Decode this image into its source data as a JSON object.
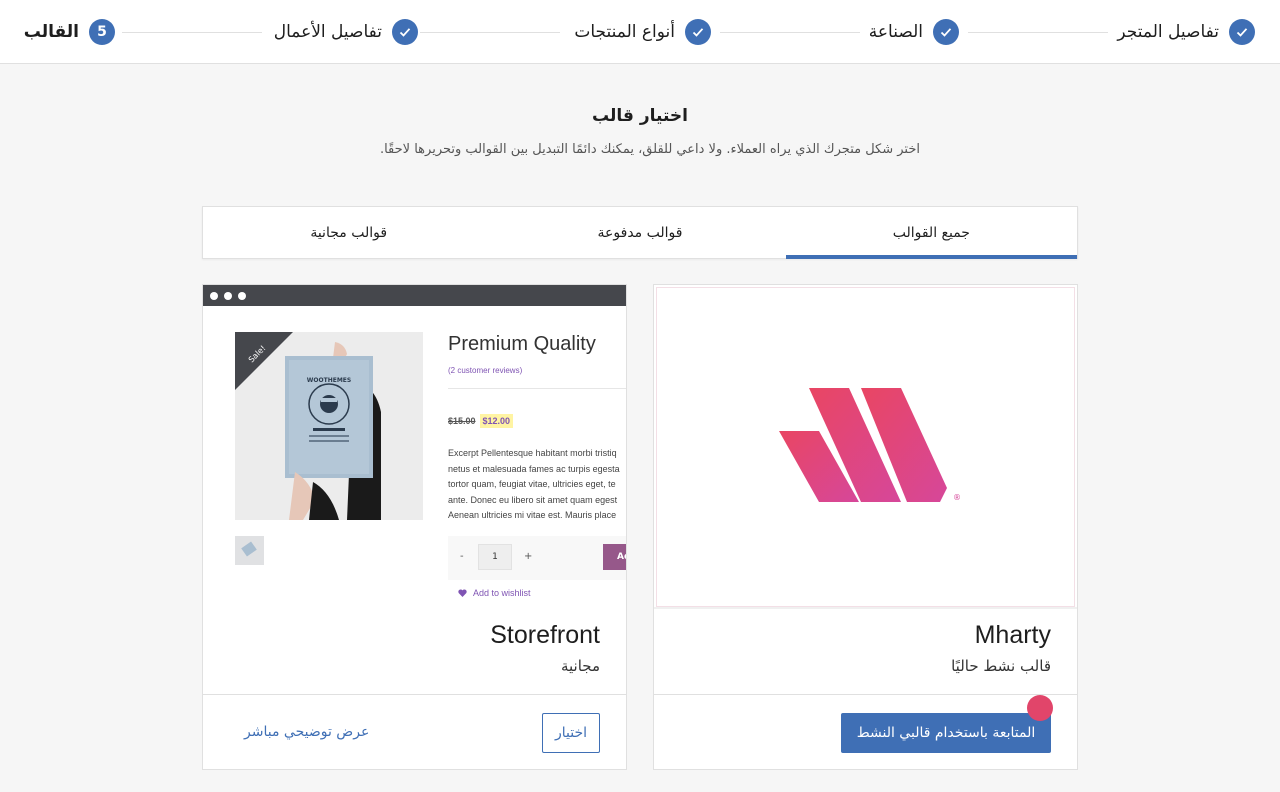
{
  "stepper": {
    "steps": [
      {
        "label": "تفاصيل المتجر",
        "state": "done"
      },
      {
        "label": "الصناعة",
        "state": "done"
      },
      {
        "label": "أنواع المنتجات",
        "state": "done"
      },
      {
        "label": "تفاصيل الأعمال",
        "state": "done"
      },
      {
        "label": "القالب",
        "state": "current",
        "number": "5"
      }
    ]
  },
  "header": {
    "title": "اختيار قالب",
    "subtitle": "اختر شكل متجرك الذي يراه العملاء. ولا داعي للقلق، يمكنك دائمًا التبديل بين القوالب وتحريرها لاحقًا."
  },
  "tabs": [
    {
      "label": "جميع القوالب",
      "active": true
    },
    {
      "label": "قوالب مدفوعة",
      "active": false
    },
    {
      "label": "قوالب مجانية",
      "active": false
    }
  ],
  "themes": {
    "mharty": {
      "name": "Mharty",
      "status": "قالب نشط حاليًا",
      "button": "المتابعة باستخدام قالبي النشط",
      "logo_colors": [
        "#e8456a",
        "#d9467e"
      ],
      "registered_mark": "®"
    },
    "storefront": {
      "name": "Storefront",
      "status": "مجانية",
      "choose_button": "اختيار",
      "demo_link": "عرض توضيحي مباشر",
      "preview": {
        "sale_badge": "Sale!",
        "product_title": "Premium Quality",
        "reviews": "(2 customer reviews)",
        "old_price": "$15.00",
        "new_price": "$12.00",
        "excerpt": [
          "Excerpt Pellentesque habitant morbi tristiq",
          "netus et malesuada fames ac turpis egesta",
          "tortor quam, feugiat vitae, ultricies eget, te",
          "ante. Donec eu libero sit amet quam egest",
          "Aenean ultricies mi vitae est. Mauris place"
        ],
        "qty_minus": "-",
        "quantity": "1",
        "qty_plus": "+",
        "add_button": "Ad",
        "wishlist": "Add to wishlist",
        "poster_text": "WOOTHEMES"
      }
    }
  },
  "colors": {
    "accent": "#3f6fb5",
    "notification": "#e1456a"
  }
}
